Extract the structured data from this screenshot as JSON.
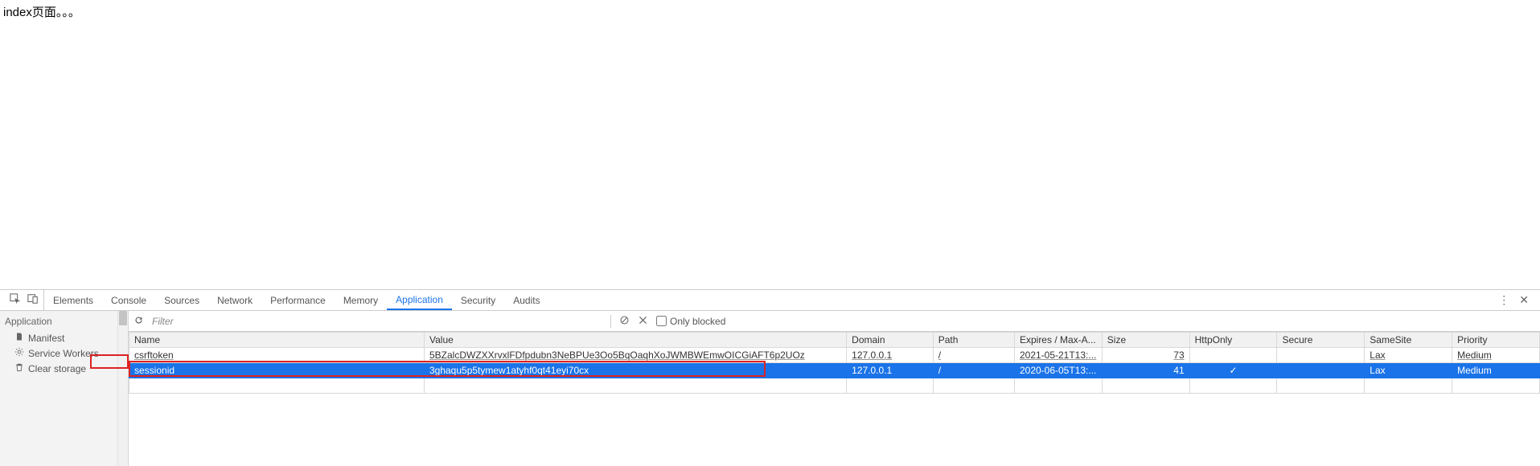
{
  "page": {
    "content_text": "index页面。。。"
  },
  "tabs": {
    "items": [
      "Elements",
      "Console",
      "Sources",
      "Network",
      "Performance",
      "Memory",
      "Application",
      "Security",
      "Audits"
    ],
    "active_index": 6
  },
  "sidebar": {
    "header": "Application",
    "items": [
      {
        "icon": "manifest",
        "label": "Manifest"
      },
      {
        "icon": "gear",
        "label": "Service Workers"
      },
      {
        "icon": "trash",
        "label": "Clear storage"
      }
    ]
  },
  "toolbar": {
    "filter_placeholder": "Filter",
    "only_blocked_label": "Only blocked"
  },
  "cookie_table": {
    "columns": [
      "Name",
      "Value",
      "Domain",
      "Path",
      "Expires / Max-A...",
      "Size",
      "HttpOnly",
      "Secure",
      "SameSite",
      "Priority"
    ],
    "rows": [
      {
        "name": "csrftoken",
        "value": "5BZalcDWZXXrvxlFDfpdubn3NeBPUe3Oo5BqOaqhXoJWMBWEmwOICGiAFT6p2UOz",
        "domain": "127.0.0.1",
        "path": "/",
        "expires": "2021-05-21T13:...",
        "size": "73",
        "httponly": "",
        "secure": "",
        "samesite": "Lax",
        "priority": "Medium",
        "selected": false,
        "underlined": true
      },
      {
        "name": "sessionid",
        "value": "3ghaqu5p5tymew1atyhf0qt41eyi70cx",
        "domain": "127.0.0.1",
        "path": "/",
        "expires": "2020-06-05T13:...",
        "size": "41",
        "httponly": "✓",
        "secure": "",
        "samesite": "Lax",
        "priority": "Medium",
        "selected": true,
        "underlined": false
      }
    ]
  }
}
